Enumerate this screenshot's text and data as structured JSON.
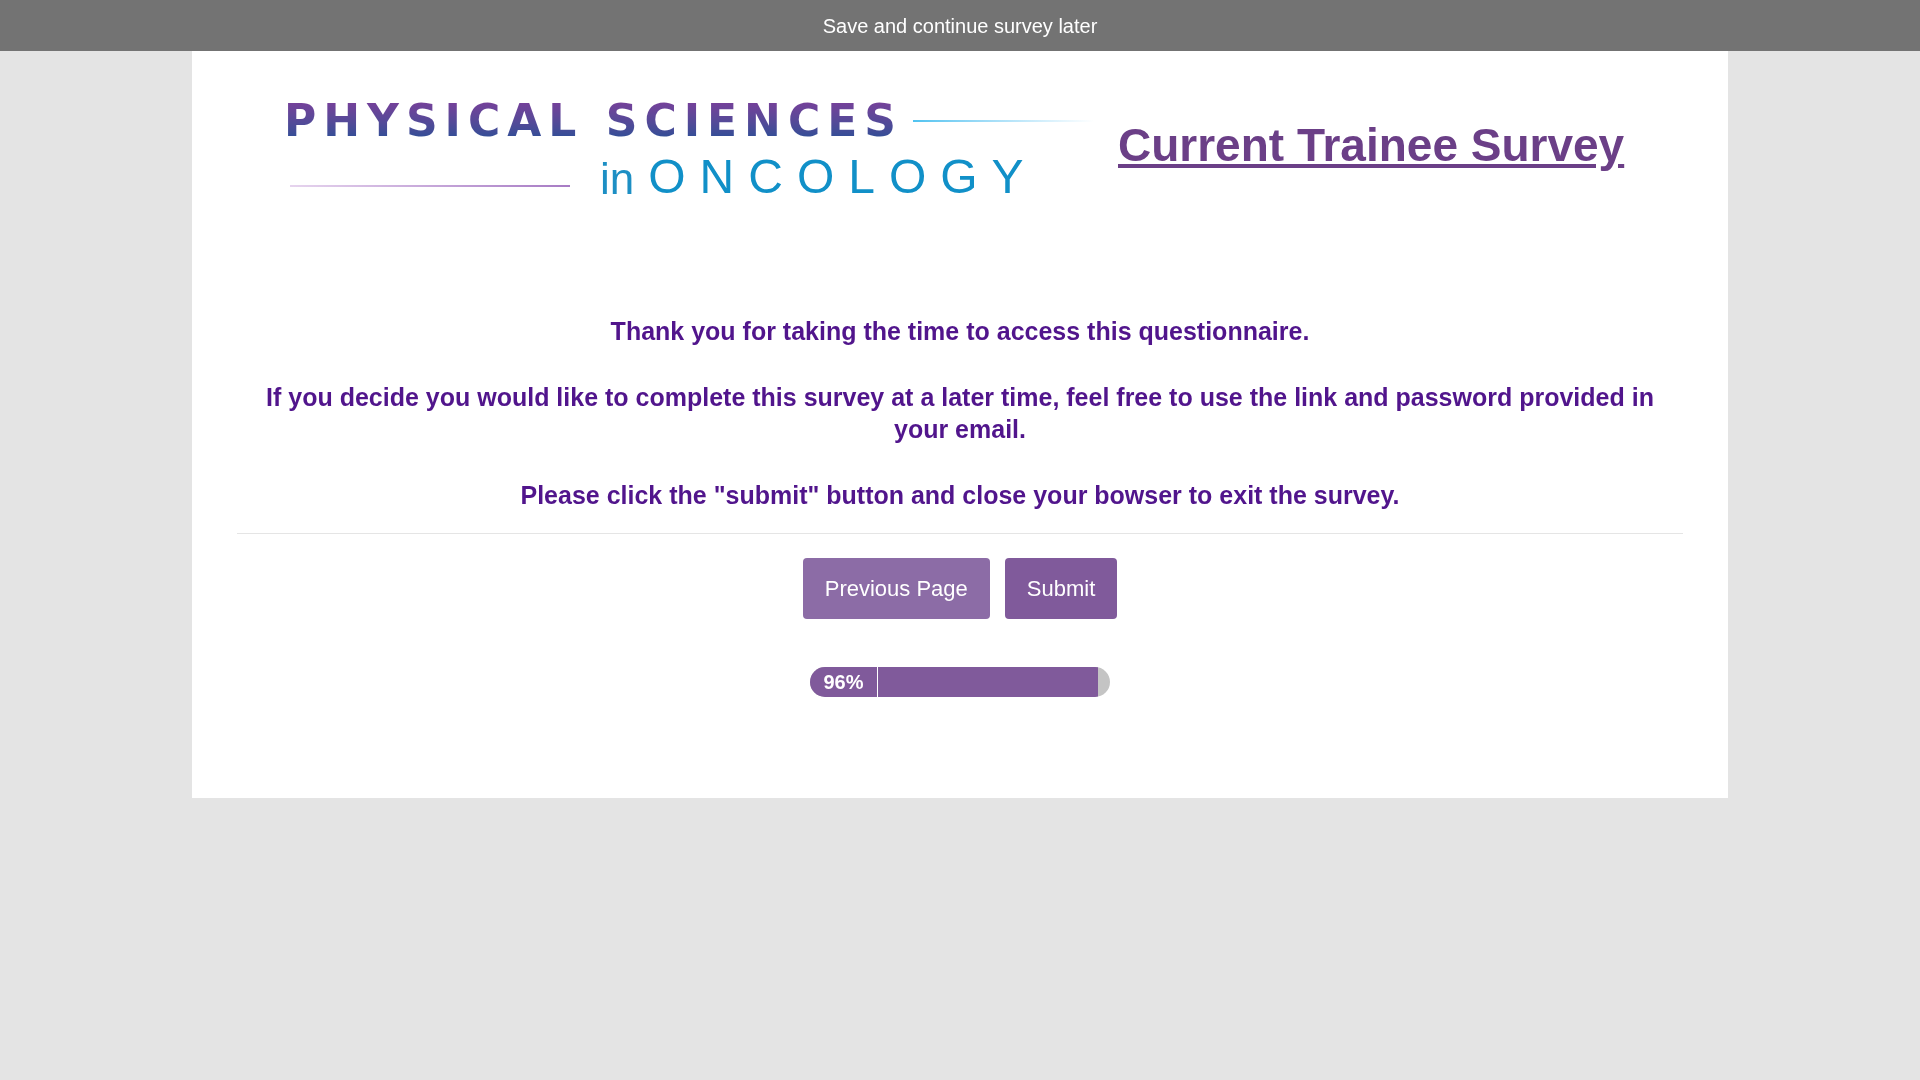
{
  "top_bar": {
    "link": "Save and continue survey later"
  },
  "logo": {
    "line_1": "PHYSICAL SCIENCES",
    "line_2_small": "in",
    "line_2": "ONCOLOGY"
  },
  "title": "Current Trainee Survey",
  "messages": [
    "Thank you for taking the time to access this questionnaire.",
    "If you decide you would like to complete this survey at a later time, feel free to use the link and password provided in your email.",
    "Please click the \"submit\" button and close your bowser to exit the survey."
  ],
  "buttons": [
    {
      "label": "Previous Page",
      "kind": "secondary"
    },
    {
      "label": "Submit",
      "kind": "primary"
    }
  ],
  "progress": {
    "label": "96%",
    "level": 0.96
  }
}
